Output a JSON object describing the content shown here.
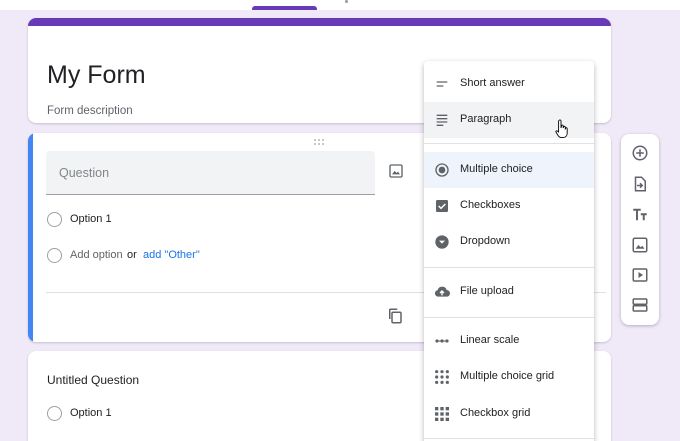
{
  "header": {
    "active_tab": "Questions"
  },
  "form": {
    "title": "My Form",
    "description": "Form description"
  },
  "question_card": {
    "placeholder": "Question",
    "option_1": "Option 1",
    "add_option": "Add option",
    "or": "or",
    "add_other": "add \"Other\""
  },
  "second_card": {
    "title": "Untitled Question",
    "option_1": "Option 1"
  },
  "question_types": [
    {
      "label": "Short answer",
      "icon": "short-answer-icon"
    },
    {
      "label": "Paragraph",
      "icon": "paragraph-icon"
    },
    {
      "label": "Multiple choice",
      "icon": "radio-button-icon"
    },
    {
      "label": "Checkboxes",
      "icon": "checkbox-icon"
    },
    {
      "label": "Dropdown",
      "icon": "dropdown-icon"
    },
    {
      "label": "File upload",
      "icon": "cloud-upload-icon"
    },
    {
      "label": "Linear scale",
      "icon": "linear-scale-icon"
    },
    {
      "label": "Multiple choice grid",
      "icon": "grid-dots-icon"
    },
    {
      "label": "Checkbox grid",
      "icon": "grid-squares-icon"
    }
  ],
  "selected_type": "Multiple choice",
  "hovered_type": "Paragraph",
  "toolbar": [
    "add-question-icon",
    "import-questions-icon",
    "add-title-icon",
    "add-image-icon",
    "add-video-icon",
    "add-section-icon"
  ],
  "colors": {
    "accent": "#673ab7",
    "active_border": "#4285f4",
    "background": "#efe9f8",
    "link": "#1a73e8"
  }
}
